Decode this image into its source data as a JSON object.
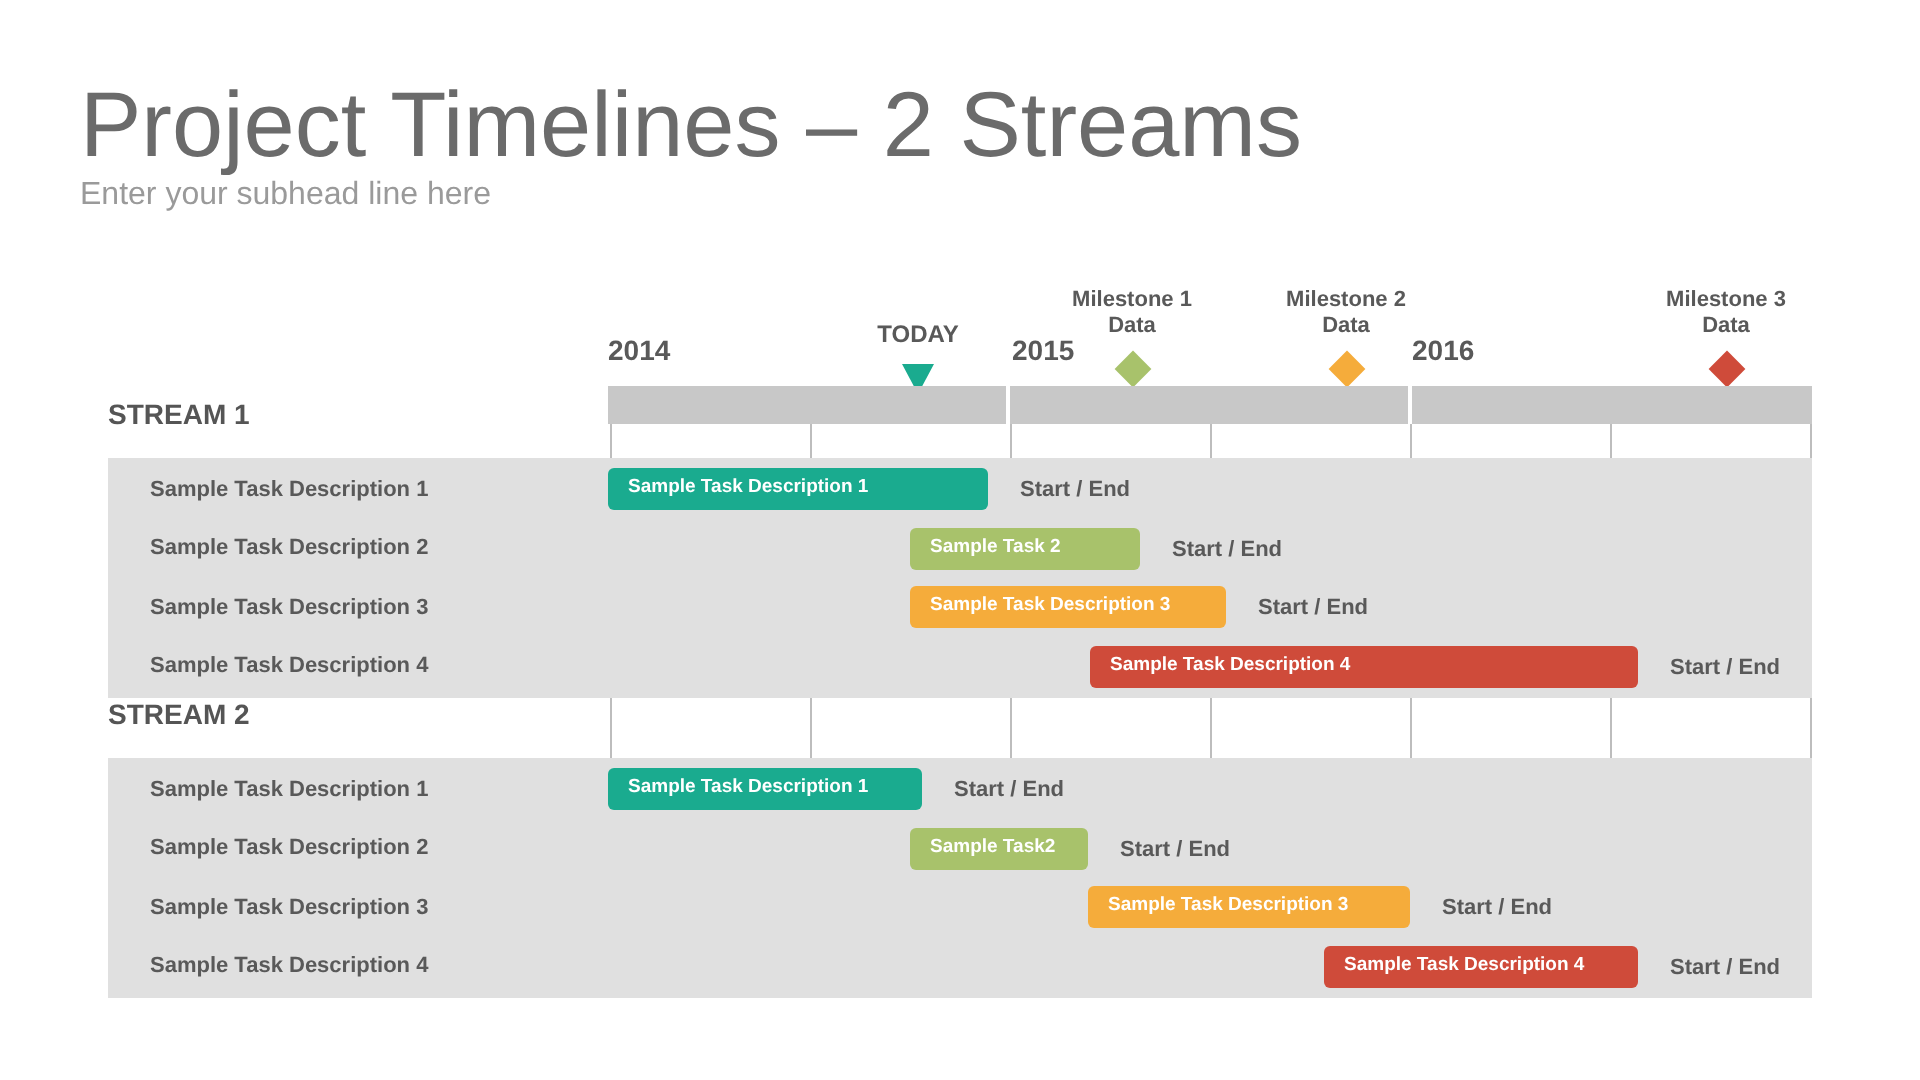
{
  "title": "Project Timelines – 2 Streams",
  "subhead": "Enter your subhead line here",
  "years": [
    "2014",
    "2015",
    "2016"
  ],
  "today": {
    "label": "TODAY",
    "color": "#1aab8f"
  },
  "milestones": [
    {
      "label": "Milestone 1 Data",
      "color": "#a8c26b"
    },
    {
      "label": "Milestone 2 Data",
      "color": "#f5ac3b"
    },
    {
      "label": "Milestone 3 Data",
      "color": "#cf4b3a"
    }
  ],
  "streams": [
    {
      "name": "STREAM 1",
      "tasks": [
        {
          "label": "Sample Task Description 1",
          "bar_label": "Sample Task Description 1",
          "note": "Start / End",
          "color": "#1aab8f"
        },
        {
          "label": "Sample Task Description 2",
          "bar_label": "Sample Task 2",
          "note": "Start / End",
          "color": "#a8c26b"
        },
        {
          "label": "Sample Task Description 3",
          "bar_label": "Sample Task Description 3",
          "note": "Start / End",
          "color": "#f5ac3b"
        },
        {
          "label": "Sample Task Description 4",
          "bar_label": "Sample Task Description 4",
          "note": "Start / End",
          "color": "#cf4b3a"
        }
      ]
    },
    {
      "name": "STREAM 2",
      "tasks": [
        {
          "label": "Sample Task Description 1",
          "bar_label": "Sample Task Description 1",
          "note": "Start / End",
          "color": "#1aab8f"
        },
        {
          "label": "Sample Task Description 2",
          "bar_label": "Sample Task2",
          "note": "Start / End",
          "color": "#a8c26b"
        },
        {
          "label": "Sample Task Description 3",
          "bar_label": "Sample Task Description 3",
          "note": "Start / End",
          "color": "#f5ac3b"
        },
        {
          "label": "Sample Task Description 4",
          "bar_label": "Sample Task Description 4",
          "note": "Start / End",
          "color": "#cf4b3a"
        }
      ]
    }
  ]
}
